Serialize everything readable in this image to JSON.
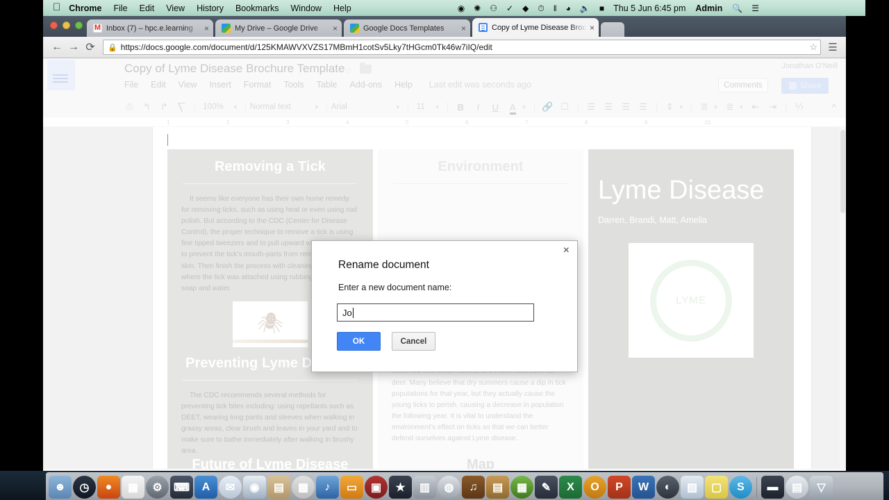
{
  "menubar": {
    "apple_icon": "apple-logo",
    "items": [
      {
        "label": "Chrome",
        "bold": true
      },
      {
        "label": "File",
        "bold": false
      },
      {
        "label": "Edit",
        "bold": false
      },
      {
        "label": "View",
        "bold": false
      },
      {
        "label": "History",
        "bold": false
      },
      {
        "label": "Bookmarks",
        "bold": false
      },
      {
        "label": "Window",
        "bold": false
      },
      {
        "label": "Help",
        "bold": false
      }
    ],
    "status_icons": [
      "record-icon",
      "sync-icon",
      "bell-icon",
      "checkmark-icon",
      "stack-icon",
      "time-machine-icon",
      "bluetooth-icon",
      "wifi-icon",
      "volume-icon",
      "battery-icon"
    ],
    "datetime": "Thu 5 Jun  6:45 pm",
    "user": "Admin",
    "search_icon": "search-icon",
    "notification_icon": "notification-center-icon"
  },
  "browser": {
    "tabs": [
      {
        "title": "Inbox (7) – hpc.e.learning",
        "favicon": "gmail-icon",
        "active": false
      },
      {
        "title": "My Drive – Google Drive",
        "favicon": "drive-icon",
        "active": false
      },
      {
        "title": "Google Docs Templates",
        "favicon": "drive-icon",
        "active": false
      },
      {
        "title": "Copy of Lyme Disease Broc",
        "favicon": "docs-icon",
        "active": true
      }
    ],
    "close_label": "×",
    "back_icon": "back-arrow-icon",
    "forward_icon": "forward-arrow-icon",
    "reload_icon": "reload-icon",
    "lock_icon": "lock-icon",
    "url": "https://docs.google.com/document/d/125KMAWVXVZS17MBmH1cotSv5Lky7tHGcm0Tk46w7iIQ/edit",
    "star_icon": "bookmark-star-icon",
    "menu_icon": "hamburger-menu-icon"
  },
  "docs": {
    "doc_title": "Copy of Lyme Disease Brochure Template",
    "menus": [
      "File",
      "Edit",
      "View",
      "Insert",
      "Format",
      "Tools",
      "Table",
      "Add-ons",
      "Help"
    ],
    "last_edit": "Last edit was seconds ago",
    "user_name": "Jonathan O'Neill",
    "comments_label": "Comments",
    "share_label": "Share",
    "toolbar": {
      "print_icon": "print-icon",
      "undo_icon": "undo-icon",
      "redo_icon": "redo-icon",
      "paint_format_icon": "paint-format-icon",
      "zoom": "100%",
      "paragraph_style": "Normal text",
      "font": "Arial",
      "font_size": "11",
      "bold_label": "B",
      "italic_label": "I",
      "underline_label": "U",
      "text_color_label": "A",
      "link_icon": "link-icon",
      "comment_icon": "add-comment-icon",
      "align_left_icon": "align-left-icon",
      "align_center_icon": "align-center-icon",
      "align_right_icon": "align-right-icon",
      "align_justify_icon": "align-justify-icon",
      "line_spacing_icon": "line-spacing-icon",
      "numbered_list_icon": "numbered-list-icon",
      "bulleted_list_icon": "bulleted-list-icon",
      "indent_less_icon": "decrease-indent-icon",
      "indent_more_icon": "increase-indent-icon",
      "clear_format_icon": "clear-formatting-icon",
      "collapse_icon": "collapse-toolbar-icon"
    },
    "ruler_marks": [
      "1",
      "2",
      "3",
      "4",
      "5",
      "6",
      "7",
      "8",
      "9",
      "10"
    ]
  },
  "brochure": {
    "col_left": {
      "heading": "Removing a Tick",
      "paragraph": "It seems like everyone has their own home remedy for removing ticks, such as using heat or even using nail polish. But according to the CDC (Center for Disease Control), the proper technique to remove a tick is using fine tipped tweezers and to pull upward without twisting to prevent  the tick's mouth-parts from remaining in the skin. Then finish the process with cleaning the area where the tick was attached using rubbing alcohol or soap and water.",
      "image_name": "tick-illustration",
      "heading2": "Preventing Lyme Disease",
      "paragraph2": "The CDC recommends several methods for preventing tick bites including: using repellants such as DEET, wearing long pants and sleeves when walking in grassy areas, clear brush and leaves in your yard and to make sure to bathe immediately after walking in brushy area.",
      "heading3": "Future of Lyme Disease"
    },
    "col_middle": {
      "heading": "Environment",
      "paragraph": "populations. This explains why tick populations tend to be down a year and a half after a severe winter. Cold winters knock mouse populations; this in turn reduces the probability of a tick larvae finding a host in the spring and maturing the following year. The same effect can be observed with other rodents and mammals, such as deer. Many believe that dry summers cause a dip in tick populations for that year, but they actually cause the young ticks to perish, causing a decrease in population the following year. It is vital to understand the environment's effect on ticks so that we can better defend ourselves against Lyme disease.",
      "heading2": "Map"
    },
    "col_right": {
      "title": "Lyme Disease",
      "authors": "Darren, Brandi, Matt, Amelia",
      "seal_text": "LYME"
    }
  },
  "modal": {
    "title": "Rename document",
    "label": "Enter a new document name:",
    "input_value": "Jo",
    "input_placeholder": "",
    "ok_label": "OK",
    "cancel_label": "Cancel",
    "close_label": "×"
  },
  "dock": {
    "items": [
      {
        "name": "finder",
        "color1": "#8fb6d9",
        "color2": "#5a86b5",
        "glyph": "☻"
      },
      {
        "name": "dashboard",
        "color1": "#2b3442",
        "color2": "#101723",
        "glyph": "◷"
      },
      {
        "name": "firefox",
        "color1": "#f08a24",
        "color2": "#c9450f",
        "glyph": "●"
      },
      {
        "name": "launchpad",
        "color1": "#f5f5f5",
        "color2": "#d7d7d7",
        "glyph": "▦"
      },
      {
        "name": "system-preferences",
        "color1": "#9aa2ab",
        "color2": "#5f6872",
        "glyph": "⚙"
      },
      {
        "name": "xcode",
        "color1": "#4b5668",
        "color2": "#232b36",
        "glyph": "⌨"
      },
      {
        "name": "app-store",
        "color1": "#4a8fd4",
        "color2": "#1f5ea8",
        "glyph": "A"
      },
      {
        "name": "mail",
        "color1": "#e8eef6",
        "color2": "#b9c6d6",
        "glyph": "✉"
      },
      {
        "name": "safari",
        "color1": "#e9eef3",
        "color2": "#9fb0c2",
        "glyph": "◉"
      },
      {
        "name": "contacts",
        "color1": "#d9c398",
        "color2": "#b3966a",
        "glyph": "▤"
      },
      {
        "name": "calculator",
        "color1": "#e2e2e2",
        "color2": "#bdbdbd",
        "glyph": "▩"
      },
      {
        "name": "itunes",
        "color1": "#6fa5d8",
        "color2": "#2e63a5",
        "glyph": "♪"
      },
      {
        "name": "ibooks",
        "color1": "#f2a93b",
        "color2": "#d07a12",
        "glyph": "▭"
      },
      {
        "name": "photo-booth",
        "color1": "#b33232",
        "color2": "#7a1d1d",
        "glyph": "▣"
      },
      {
        "name": "imovie",
        "color1": "#3a4250",
        "color2": "#1b212b",
        "glyph": "★"
      },
      {
        "name": "final-cut",
        "color1": "#c8cdd3",
        "color2": "#8b929b",
        "glyph": "▥"
      },
      {
        "name": "chrome",
        "color1": "#dfe3e7",
        "color2": "#9aa3ac",
        "glyph": "◍"
      },
      {
        "name": "garageband",
        "color1": "#8a5a2a",
        "color2": "#5c3616",
        "glyph": "♫"
      },
      {
        "name": "pages",
        "color1": "#c79a57",
        "color2": "#8f6a2f",
        "glyph": "▤"
      },
      {
        "name": "numbers-green",
        "color1": "#77b848",
        "color2": "#3e7a1f",
        "glyph": "▦"
      },
      {
        "name": "keynote",
        "color1": "#4a5160",
        "color2": "#262c38",
        "glyph": "✎"
      },
      {
        "name": "excel",
        "color1": "#2c8a4b",
        "color2": "#1d6a35",
        "glyph": "X"
      },
      {
        "name": "outlook",
        "color1": "#e8a22a",
        "color2": "#c07a10",
        "glyph": "O"
      },
      {
        "name": "powerpoint",
        "color1": "#d24726",
        "color2": "#a13318",
        "glyph": "P"
      },
      {
        "name": "word",
        "color1": "#3b73b9",
        "color2": "#24538f",
        "glyph": "W"
      },
      {
        "name": "time-machine",
        "color1": "#59626d",
        "color2": "#2c333c",
        "glyph": "◐"
      },
      {
        "name": "preview",
        "color1": "#e4ecf3",
        "color2": "#aebfd0",
        "glyph": "▨"
      },
      {
        "name": "stickies",
        "color1": "#f3e37a",
        "color2": "#d9c642",
        "glyph": "▢"
      },
      {
        "name": "skype",
        "color1": "#5fb8e8",
        "color2": "#1d8ec4",
        "glyph": "S"
      },
      {
        "name": "separator",
        "color1": "",
        "color2": "",
        "glyph": ""
      },
      {
        "name": "printer",
        "color1": "#3c4450",
        "color2": "#1d232c",
        "glyph": "▬"
      },
      {
        "name": "documents-stack",
        "color1": "#e9edf1",
        "color2": "#b6bfc9",
        "glyph": "▤"
      },
      {
        "name": "trash",
        "color1": "#cfd6dc",
        "color2": "#97a1ab",
        "glyph": "▽"
      }
    ]
  }
}
